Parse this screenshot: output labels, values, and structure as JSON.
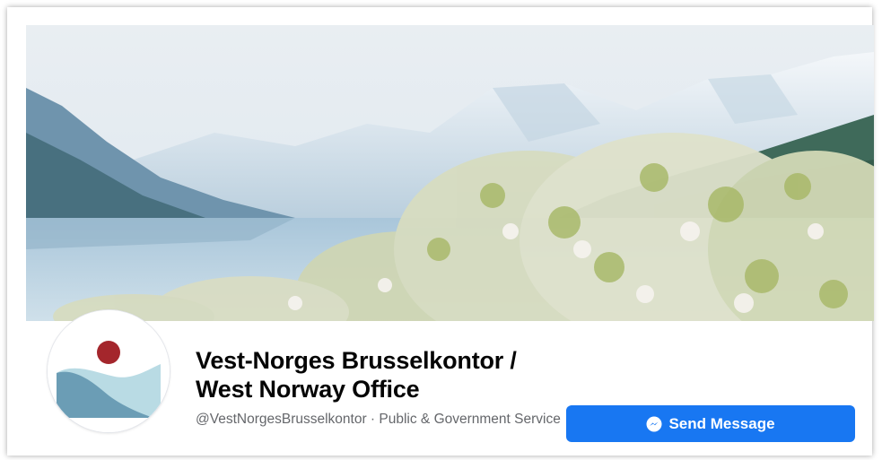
{
  "page": {
    "name": "Vest-Norges Brusselkontor / West Norway Office",
    "handle_category": "@VestNorgesBrusselkontor · Public & Government Service"
  },
  "cover": {
    "description_icon": "landscape-photo"
  },
  "avatar": {
    "logo_icon": "west-norway-office-logo"
  },
  "actions": {
    "send_message_label": "Send Message",
    "send_message_icon": "messenger-icon"
  },
  "colors": {
    "primary_button": "#1877f2",
    "title_text": "#050505",
    "secondary_text": "#65676b",
    "logo_red": "#a4262c",
    "logo_blue_dark": "#6b9db5",
    "logo_blue_light": "#b9dbe4"
  }
}
